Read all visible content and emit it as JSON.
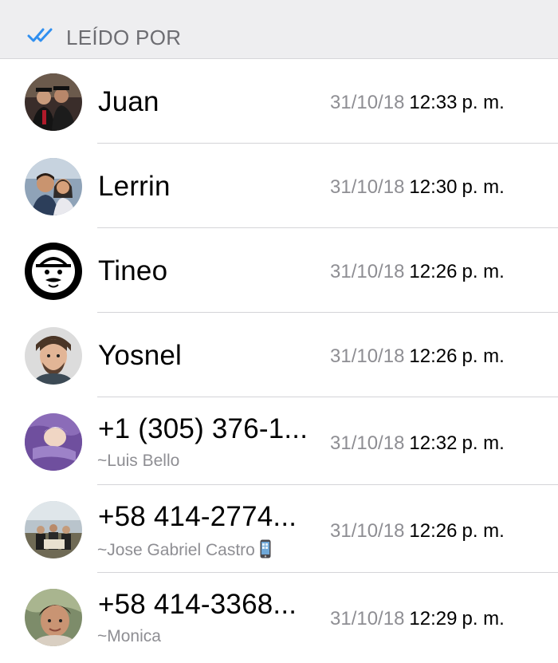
{
  "header": {
    "title": "LEÍDO POR",
    "icon": "double-check-icon",
    "check_color": "#2f8ff0"
  },
  "readers": [
    {
      "name": "Juan",
      "subname": "",
      "date": "31/10/18",
      "time": "12:33",
      "ampm": "p. m.",
      "avatar": "graduation-photo"
    },
    {
      "name": "Lerrin",
      "subname": "",
      "date": "31/10/18",
      "time": "12:30",
      "ampm": "p. m.",
      "avatar": "couple-photo"
    },
    {
      "name": "Tineo",
      "subname": "",
      "date": "31/10/18",
      "time": "12:26",
      "ampm": "p. m.",
      "avatar": "cartoon-face"
    },
    {
      "name": "Yosnel",
      "subname": "",
      "date": "31/10/18",
      "time": "12:26",
      "ampm": "p. m.",
      "avatar": "selfie-photo"
    },
    {
      "name": "+1 (305) 376-1...",
      "subname": "~Luis Bello",
      "date": "31/10/18",
      "time": "12:32",
      "ampm": "p. m.",
      "avatar": "baby-photo"
    },
    {
      "name": "+58 414-2774...",
      "subname": "~Jose Gabriel Castro",
      "subname_icon": "mobile-phone-emoji",
      "date": "31/10/18",
      "time": "12:26",
      "ampm": "p. m.",
      "avatar": "group-photo"
    },
    {
      "name": "+58 414-3368...",
      "subname": "~Monica",
      "date": "31/10/18",
      "time": "12:29",
      "ampm": "p. m.",
      "avatar": "woman-photo"
    }
  ]
}
